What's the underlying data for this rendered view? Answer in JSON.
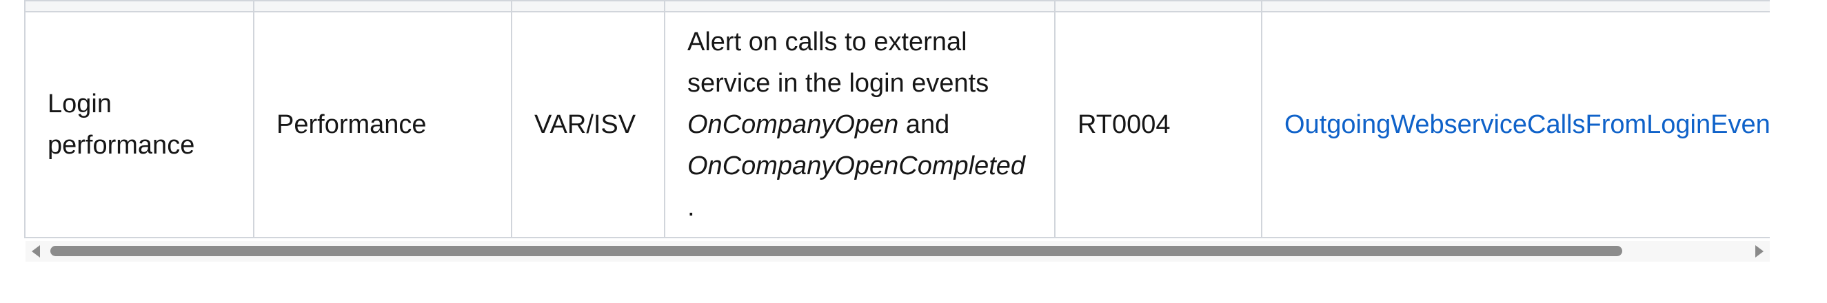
{
  "table": {
    "rows": [
      {
        "area": "Login performance",
        "category": "Performance",
        "audience": "VAR/ISV",
        "description": {
          "prefix": "Alert on calls to external service in the login events",
          "event1": "OnCompanyOpen",
          "joiner": "and",
          "event2": "OnCompanyOpenCompleted",
          "suffix": "."
        },
        "code": "RT0004",
        "link_text": "OutgoingWebserviceCallsFromLoginEvents"
      }
    ]
  },
  "scrollbar": {
    "left_arrow_icon": "triangle-left-icon",
    "right_arrow_icon": "triangle-right-icon",
    "thumb_start_fraction": 0.0,
    "thumb_visible_fraction": 0.9274
  },
  "colors": {
    "link": "#0f62c9",
    "border": "#d1d5db",
    "scroll_thumb": "#8c8c8c"
  }
}
